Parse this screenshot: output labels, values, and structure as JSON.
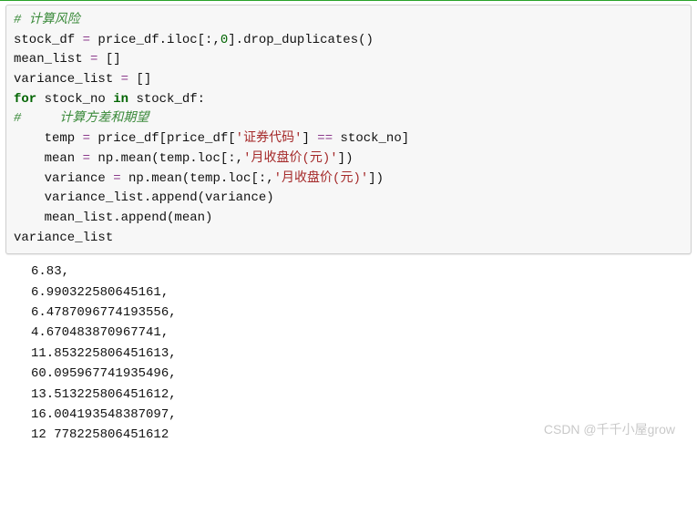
{
  "code": {
    "l1_comment": "# 计算风险",
    "l2_a": "stock_df ",
    "l2_b": "=",
    "l2_c": " price_df.iloc[:,",
    "l2_d": "0",
    "l2_e": "].drop_duplicates()",
    "l3_a": "mean_list ",
    "l3_b": "=",
    "l3_c": " []",
    "l4_a": "variance_list ",
    "l4_b": "=",
    "l4_c": " []",
    "l5_a": "for",
    "l5_b": " stock_no ",
    "l5_c": "in",
    "l5_d": " stock_df:",
    "l6_comment": "#     计算方差和期望",
    "l7_a": "    temp ",
    "l7_b": "=",
    "l7_c": " price_df[price_df[",
    "l7_d": "'证券代码'",
    "l7_e": "] ",
    "l7_f": "==",
    "l7_g": " stock_no]",
    "l8_a": "    mean ",
    "l8_b": "=",
    "l8_c": " np.mean(temp.loc[:,",
    "l8_d": "'月收盘价(元)'",
    "l8_e": "])",
    "l9_a": "    variance ",
    "l9_b": "=",
    "l9_c": " np.mean(temp.loc[:,",
    "l9_d": "'月收盘价(元)'",
    "l9_e": "])",
    "l10": "    variance_list.append(variance)",
    "l11": "    mean_list.append(mean)",
    "l12": "variance_list"
  },
  "output": {
    "v1": " 6.83,",
    "v2": " 6.990322580645161,",
    "v3": " 6.4787096774193556,",
    "v4": " 4.670483870967741,",
    "v5": " 11.853225806451613,",
    "v6": " 60.095967741935496,",
    "v7": " 13.513225806451612,",
    "v8": " 16.004193548387097,",
    "v9": " 12 778225806451612"
  },
  "watermark": "CSDN @千千小屋grow"
}
